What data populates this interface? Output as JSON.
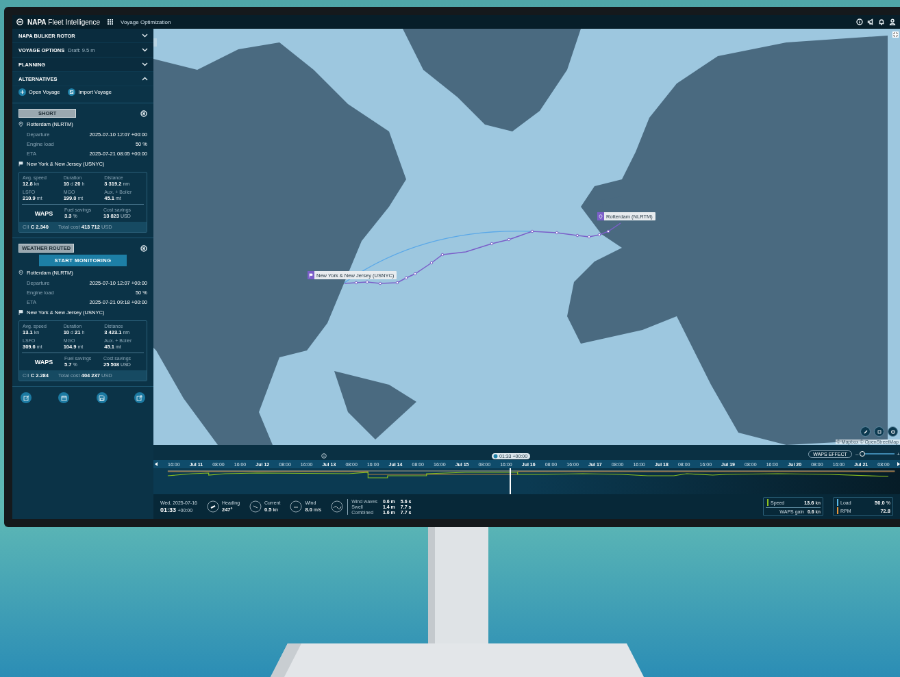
{
  "header": {
    "brand": "**NAPA** Fleet Intelligence",
    "app_title": "Voyage Optimization"
  },
  "sidebar": {
    "sections": [
      {
        "title": "NAPA BULKER ROTOR",
        "expanded": false
      },
      {
        "title": "VOYAGE OPTIONS",
        "subtitle": "Draft: 9.5 m",
        "expanded": false
      },
      {
        "title": "PLANNING",
        "expanded": false
      },
      {
        "title": "ALTERNATIVES",
        "expanded": true
      }
    ],
    "actions": [
      {
        "label": "Open Voyage",
        "kind": "add"
      },
      {
        "label": "Import Voyage",
        "kind": "import"
      }
    ],
    "alternatives": [
      {
        "tag": "SHORT",
        "origin": "Rotterdam (NLRTM)",
        "rows": [
          {
            "label": "Departure",
            "value": "2025-07-10 12:07 +00:00"
          },
          {
            "label": "Engine load",
            "value": "50 %"
          },
          {
            "label": "ETA",
            "value": "2025-07-21 08:05 +00:00"
          }
        ],
        "destination": "New York & New Jersey (USNYC)",
        "stats": [
          {
            "label": "Avg. speed",
            "parts": [
              {
                "v": "12.8",
                "u": "kn"
              }
            ]
          },
          {
            "label": "Duration",
            "parts": [
              {
                "v": "10",
                "u": "d"
              },
              {
                "v": "20",
                "u": "h"
              }
            ]
          },
          {
            "label": "Distance",
            "parts": [
              {
                "v": "3 319.2",
                "u": "nm"
              }
            ]
          },
          {
            "label": "LSFO",
            "parts": [
              {
                "v": "210.9",
                "u": "mt"
              }
            ]
          },
          {
            "label": "MGO",
            "parts": [
              {
                "v": "199.0",
                "u": "mt"
              }
            ]
          },
          {
            "label": "Aux. + Boiler",
            "parts": [
              {
                "v": "45.1",
                "u": "mt"
              }
            ]
          }
        ],
        "waps": {
          "label": "WAPS",
          "stats": [
            {
              "label": "Fuel savings",
              "parts": [
                {
                  "v": "3.3",
                  "u": "%"
                }
              ]
            },
            {
              "label": "Cost savings",
              "parts": [
                {
                  "v": "13 823",
                  "u": "USD"
                }
              ]
            }
          ]
        },
        "footer": {
          "cii_label": "CII",
          "cii": "C 2.340",
          "total_label": "Total cost",
          "total": "413 712",
          "total_unit": "USD"
        }
      },
      {
        "tag": "WEATHER ROUTED",
        "monitor_button": "START MONITORING",
        "origin": "Rotterdam (NLRTM)",
        "rows": [
          {
            "label": "Departure",
            "value": "2025-07-10 12:07 +00:00"
          },
          {
            "label": "Engine load",
            "value": "50 %"
          },
          {
            "label": "ETA",
            "value": "2025-07-21 09:18 +00:00"
          }
        ],
        "destination": "New York & New Jersey (USNYC)",
        "stats": [
          {
            "label": "Avg. speed",
            "parts": [
              {
                "v": "13.1",
                "u": "kn"
              }
            ]
          },
          {
            "label": "Duration",
            "parts": [
              {
                "v": "10",
                "u": "d"
              },
              {
                "v": "21",
                "u": "h"
              }
            ]
          },
          {
            "label": "Distance",
            "parts": [
              {
                "v": "3 423.1",
                "u": "nm"
              }
            ]
          },
          {
            "label": "LSFO",
            "parts": [
              {
                "v": "309.6",
                "u": "mt"
              }
            ]
          },
          {
            "label": "MGO",
            "parts": [
              {
                "v": "104.9",
                "u": "mt"
              }
            ]
          },
          {
            "label": "Aux. + Boiler",
            "parts": [
              {
                "v": "45.1",
                "u": "mt"
              }
            ]
          }
        ],
        "waps": {
          "label": "WAPS",
          "stats": [
            {
              "label": "Fuel savings",
              "parts": [
                {
                  "v": "5.7",
                  "u": "%"
                }
              ]
            },
            {
              "label": "Cost savings",
              "parts": [
                {
                  "v": "25 508",
                  "u": "USD"
                }
              ]
            }
          ]
        },
        "footer": {
          "cii_label": "CII",
          "cii": "C 2.284",
          "total_label": "Total cost",
          "total": "404 237",
          "total_unit": "USD"
        }
      }
    ],
    "tools": [
      {
        "kind": "edit"
      },
      {
        "kind": "calendar"
      },
      {
        "kind": "save"
      },
      {
        "kind": "export"
      }
    ]
  },
  "map": {
    "ports": [
      {
        "name": "New York & New Jersey (USNYC)",
        "kind": "destination"
      },
      {
        "name": "Rotterdam (NLRTM)",
        "kind": "origin"
      }
    ],
    "attribution": "© Mapbox © OpenStreetMap"
  },
  "timeline": {
    "cursor": "01:33 +00:00",
    "waps_button": "WAPS EFFECT",
    "waps_slider": {
      "minus": "–",
      "plus": "+",
      "level": 0.05
    },
    "ticks": [
      {
        "label": "16:00",
        "day": false
      },
      {
        "label": "Jul 11",
        "day": true
      },
      {
        "label": "08:00",
        "day": false
      },
      {
        "label": "16:00",
        "day": false
      },
      {
        "label": "Jul 12",
        "day": true
      },
      {
        "label": "08:00",
        "day": false
      },
      {
        "label": "16:00",
        "day": false
      },
      {
        "label": "Jul 13",
        "day": true
      },
      {
        "label": "08:00",
        "day": false
      },
      {
        "label": "16:00",
        "day": false
      },
      {
        "label": "Jul 14",
        "day": true
      },
      {
        "label": "08:00",
        "day": false
      },
      {
        "label": "16:00",
        "day": false
      },
      {
        "label": "Jul 15",
        "day": true
      },
      {
        "label": "08:00",
        "day": false
      },
      {
        "label": "16:00",
        "day": false
      },
      {
        "label": "Jul 16",
        "day": true
      },
      {
        "label": "08:00",
        "day": false
      },
      {
        "label": "16:00",
        "day": false
      },
      {
        "label": "Jul 17",
        "day": true
      },
      {
        "label": "08:00",
        "day": false
      },
      {
        "label": "16:00",
        "day": false
      },
      {
        "label": "Jul 18",
        "day": true
      },
      {
        "label": "08:00",
        "day": false
      },
      {
        "label": "16:00",
        "day": false
      },
      {
        "label": "Jul 19",
        "day": true
      },
      {
        "label": "08:00",
        "day": false
      },
      {
        "label": "16:00",
        "day": false
      },
      {
        "label": "Jul 20",
        "day": true
      },
      {
        "label": "08:00",
        "day": false
      },
      {
        "label": "16:00",
        "day": false
      },
      {
        "label": "Jul 21",
        "day": true
      },
      {
        "label": "08:00",
        "day": false
      }
    ]
  },
  "status": {
    "date": "Wed, 2025-07-16",
    "time": "01:33",
    "tz": "+00:00",
    "gauges": [
      {
        "label": "Heading",
        "value": "247°",
        "kind": "heading"
      },
      {
        "label": "Current",
        "value": "0.5",
        "unit": "kn",
        "kind": "current"
      },
      {
        "label": "Wind",
        "value": "8.0",
        "unit": "m/s",
        "kind": "wind"
      }
    ],
    "waves": [
      {
        "label": "Wind waves",
        "height": "0.6 m",
        "period": "5.6 s"
      },
      {
        "label": "Swell",
        "height": "1.4 m",
        "period": "7.7 s"
      },
      {
        "label": "Combined",
        "height": "1.6 m",
        "period": "7.7 s"
      }
    ],
    "legend": [
      {
        "items": [
          {
            "label": "Speed",
            "value": "13.6",
            "unit": "kn",
            "color": "#8dc21f"
          },
          {
            "label": "WAPS gain",
            "value": "0.6",
            "unit": "kn",
            "kind": "sub"
          }
        ]
      },
      {
        "items": [
          {
            "label": "Load",
            "value": "50.0",
            "unit": "%",
            "color": "#5bb8e6"
          },
          {
            "label": "RPM",
            "value": "72.8",
            "color": "#e8963a"
          }
        ]
      }
    ]
  }
}
